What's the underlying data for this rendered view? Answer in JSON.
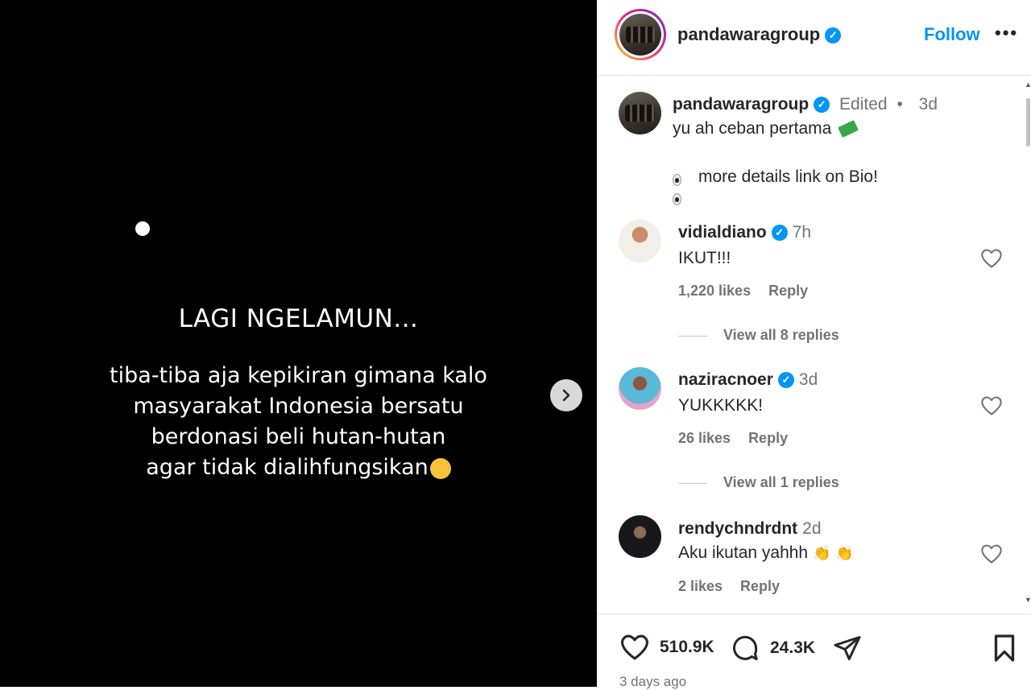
{
  "media": {
    "headline": "LAGI NGELAMUN...",
    "story_lines": [
      "tiba-tiba aja kepikiran gimana kalo",
      "masyarakat Indonesia bersatu",
      "berdonasi beli hutan-hutan",
      "agar tidak dialihfungsikan"
    ],
    "next_icon": "chevron-right-icon"
  },
  "header": {
    "username": "pandawaragroup",
    "follow_label": "Follow",
    "more_label": "•••"
  },
  "caption": {
    "username": "pandawaragroup",
    "edited": "Edited",
    "separator": "•",
    "time": "3d",
    "text_line1": "yu ah ceban pertama",
    "text_line2": "more details link on Bio!"
  },
  "comments": [
    {
      "username": "vidialdiano",
      "verified": true,
      "time": "7h",
      "text": "IKUT!!!",
      "likes": "1,220 likes",
      "reply": "Reply",
      "view_replies": "View all 8 replies"
    },
    {
      "username": "naziracnoer",
      "verified": true,
      "time": "3d",
      "text": "YUKKKKK!",
      "likes": "26 likes",
      "reply": "Reply",
      "view_replies": "View all 1 replies"
    },
    {
      "username": "rendychndrdnt",
      "verified": false,
      "time": "2d",
      "text": "Aku ikutan yahhh",
      "likes": "2 likes",
      "reply": "Reply"
    }
  ],
  "actions": {
    "likes_count": "510.9K",
    "comments_count": "24.3K"
  },
  "post_date": "3 days ago",
  "colors": {
    "accent": "#0095f6",
    "text": "#262626",
    "muted": "#737373"
  }
}
